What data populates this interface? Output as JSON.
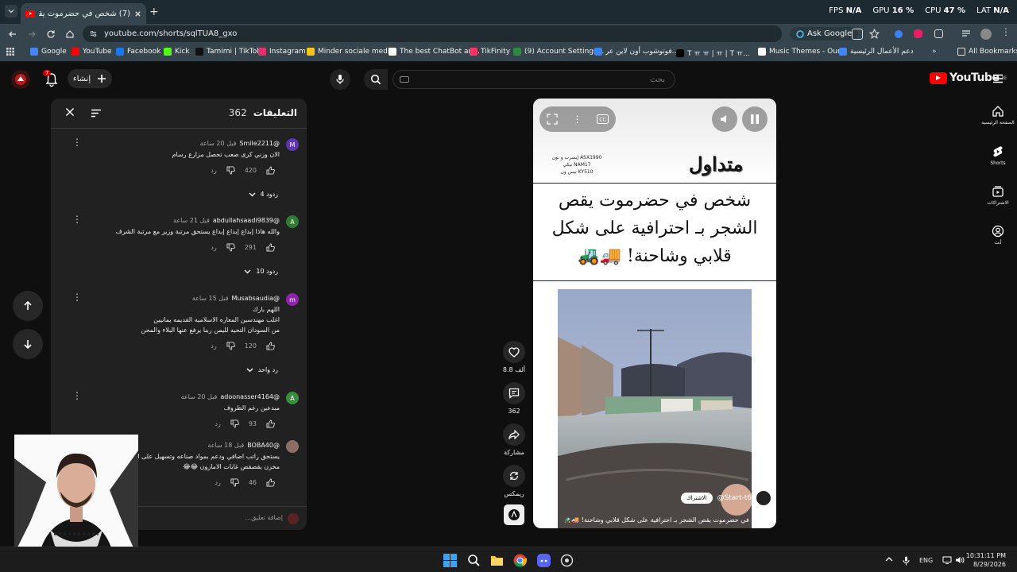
{
  "browser": {
    "tab_title": "(7) شخص في حضرموت يقص...",
    "new_tab": "+",
    "perf": {
      "fps_label": "FPS",
      "fps_value": "N/A",
      "gpu_label": "GPU",
      "gpu_value": "16 %",
      "cpu_label": "CPU",
      "cpu_value": "47 %",
      "lat_label": "LAT",
      "lat_value": "N/A"
    },
    "url": "youtube.com/shorts/sqlTUA8_gxo",
    "ask_google": "Ask Google",
    "bookmarks": [
      {
        "label": "Google",
        "color": "#4285f4"
      },
      {
        "label": "YouTube",
        "color": "#ff0000"
      },
      {
        "label": "Facebook",
        "color": "#1877f2"
      },
      {
        "label": "Kick",
        "color": "#53fc18"
      },
      {
        "label": "Tamimi | TikTok",
        "color": "#111111"
      },
      {
        "label": "Instagram",
        "color": "#e1306c"
      },
      {
        "label": "Minder sociale medi...",
        "color": "#f5c518"
      },
      {
        "label": "The best ChatBot an...",
        "color": "#ffffff"
      },
      {
        "label": "TikFinity",
        "color": "#ff3366"
      },
      {
        "label": "(9) Account Settings...",
        "color": "#2b8a3e"
      },
      {
        "label": "فوتوشوب أون لاين عر...",
        "color": "#3b82f6"
      },
      {
        "label": "T ㅠ ㅠ | ㅠ | T ㅠ...",
        "color": "#000000"
      },
      {
        "label": "Music Themes - Our...",
        "color": "#ffffff"
      },
      {
        "label": "دعم الأعمال الرئيسية",
        "color": "#4285f4"
      }
    ],
    "all_bookmarks": "All Bookmarks"
  },
  "youtube": {
    "create_label": "إنشاء",
    "notif_count": "7",
    "search_placeholder": "بحث",
    "logo_text": "YouTube",
    "logo_region": "BE",
    "sidebar": [
      {
        "label": "الصفحة الرئيسية",
        "icon": "home-icon"
      },
      {
        "label": "Shorts",
        "icon": "shorts-icon"
      },
      {
        "label": "الاشتراكات",
        "icon": "subscriptions-icon"
      },
      {
        "label": "أنت",
        "icon": "you-icon"
      }
    ]
  },
  "comments": {
    "title": "التعليقات",
    "count": "362",
    "add_placeholder": "إضافة تعليق...",
    "items": [
      {
        "author": "@Smile2211",
        "time": "قبل 20 ساعة",
        "lines": [
          "الان وزني كرى صعب تحصل مزارع رسام"
        ],
        "likes": "420",
        "reply": "رد",
        "replies": "4 ردود",
        "avatar": "M",
        "avatar_color": "#5e35b1"
      },
      {
        "author": "@abdullahsaadi9839",
        "time": "قبل 21 ساعة",
        "lines": [
          "والله هاذا إبداع إبداع إبداع يستحق مرتبة وزير مع مرتبة الشرف"
        ],
        "likes": "291",
        "reply": "رد",
        "replies": "10 ردود",
        "avatar": "A",
        "avatar_color": "#2e7d32"
      },
      {
        "author": "@Musabsaudia",
        "time": "قبل 15 ساعة",
        "lines": [
          "اللهم بارك",
          "اغلب مهندسين المعاره الاسلاميه القديمه يمانيين",
          "من السودان التحيه لليمن ربنا يرفع عنها البلاء والمحن"
        ],
        "likes": "120",
        "reply": "رد",
        "replies": "رد واحد",
        "avatar": "m",
        "avatar_color": "#8e24aa"
      },
      {
        "author": "@adoonasser4164",
        "time": "قبل 20 ساعة",
        "lines": [
          "مبدعين رغم الظروف"
        ],
        "likes": "93",
        "reply": "رد",
        "replies": "",
        "avatar": "A",
        "avatar_color": "#388e3c"
      },
      {
        "author": "@BOBA40",
        "time": "قبل 18 ساعة",
        "lines": [
          "يستحق راتب اضافي ودعم بمواد صناعه وتسهيل على التزيين",
          "مخزن يقصقص غابات الامازون 😂😂"
        ],
        "likes": "46",
        "reply": "رد",
        "replies": "",
        "avatar": "",
        "avatar_color": "#8d6e63"
      }
    ]
  },
  "video": {
    "trade_label": "متداول",
    "side_info": [
      "إيسرب و نون ASX1990",
      "نيكي NAM17",
      "نيس ون KY510"
    ],
    "headline_lines": [
      "شخص في حضرموت يقص",
      "الشجر بـ احترافية على شكل",
      "قلابي وشاحنة! 🚚🚜"
    ],
    "channel": "@Start-t6",
    "subscribe": "الاشتراك",
    "caption": "شخص في حضرموت يقص الشجر بـ احترافية على شكل قلابي وشاحنة! 🚚🚜"
  },
  "actions": {
    "likes": "8.8 ألف",
    "comments": "362",
    "share": "مشاركة",
    "remix": "ريمكس"
  },
  "taskbar": {
    "lang": "ENG",
    "time": "10:31:11 PM",
    "date": "8/29/2026"
  }
}
